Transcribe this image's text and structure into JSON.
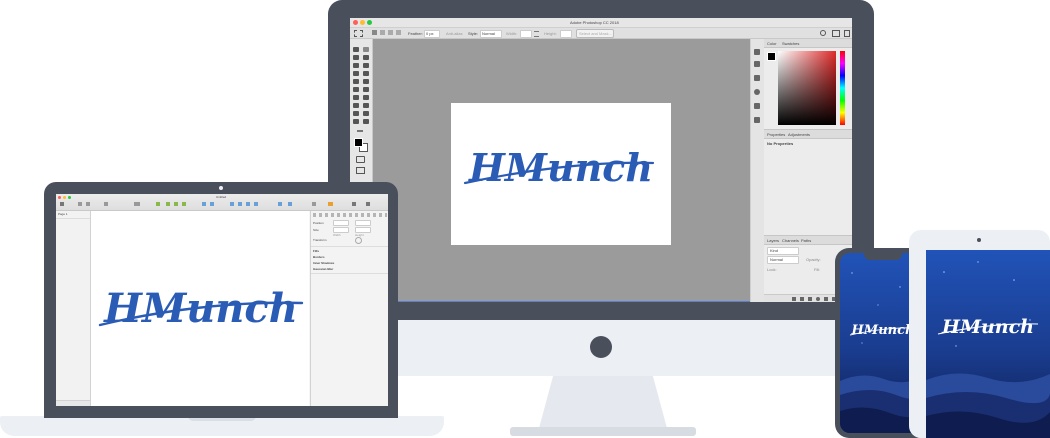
{
  "colors": {
    "bezel": "#4a4f5c",
    "bezel_light": "#eceff4",
    "stand": "#dfe3ea",
    "canvas_gray": "#9b9b9b",
    "panel_bg": "#ececec",
    "logo_blue": "#2a5cb5",
    "phone_sky_top": "#1d4aa3",
    "phone_sky_bottom": "#0e1d4f"
  },
  "imac": {
    "ps_title": "Adobe Photoshop CC 2018",
    "options": {
      "feather_label": "Feather:",
      "feather_value": "0 px",
      "anti_alias": "Anti-alias",
      "style_label": "Style:",
      "style_value": "Normal",
      "width_label": "Width:",
      "height_label": "Height:",
      "select_mask": "Select and Mask..."
    },
    "panels": {
      "tab_color": "Color",
      "tab_swatches": "Swatches",
      "tab_properties": "Properties",
      "tab_adjustments": "Adjustments",
      "no_properties": "No Properties",
      "tab_layers": "Layers",
      "tab_channels": "Channels",
      "tab_paths": "Paths",
      "layer_kind": "Kind",
      "layer_mode": "Normal",
      "layer_opacity": "Opacity:",
      "layer_lock": "Lock:",
      "layer_fill": "Fill:"
    }
  },
  "laptop": {
    "app_title": "Untitled",
    "page_item": "Page 1",
    "inspector": {
      "position": "Position",
      "size": "Size",
      "transform": "Transform",
      "width": "Width",
      "height": "Height",
      "fills": "Fills",
      "borders": "Borders",
      "inner_shadows": "Inner Shadows",
      "gaussian_blur": "Gaussian Blur"
    }
  },
  "brand": {
    "logo_text": "HMunch"
  }
}
